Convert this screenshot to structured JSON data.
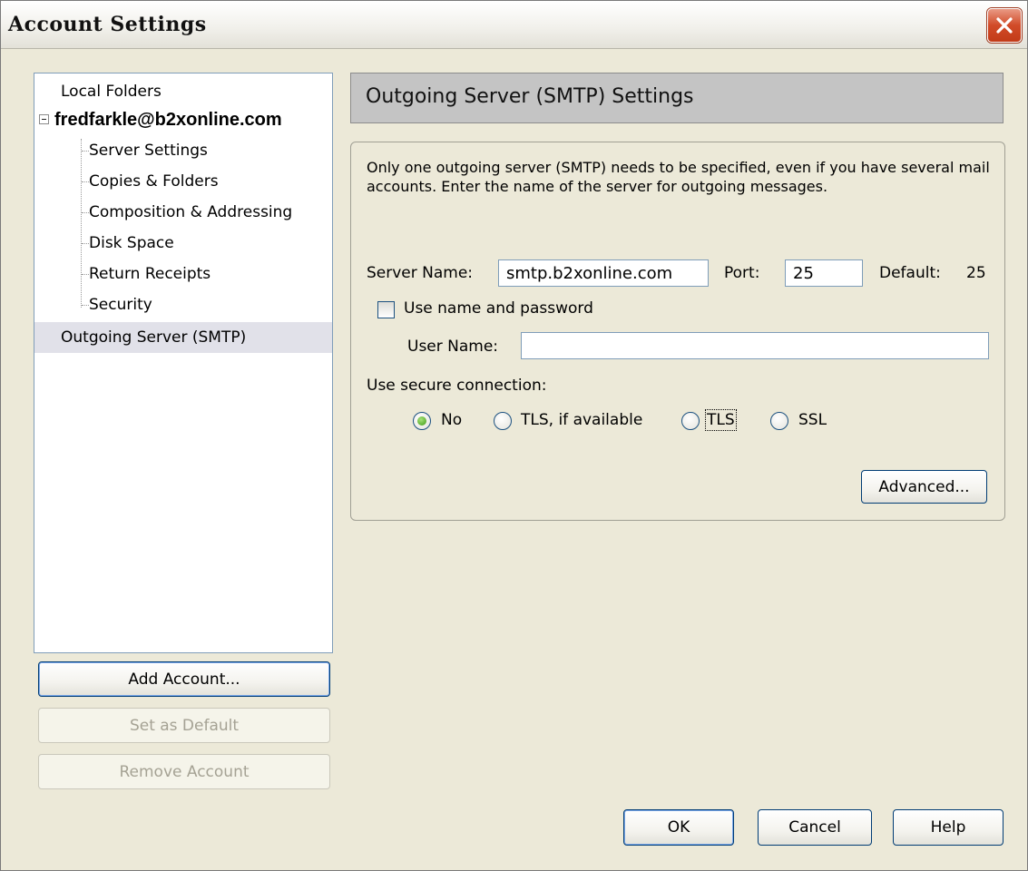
{
  "window": {
    "title": "Account Settings",
    "close_icon": "close-icon"
  },
  "tree": {
    "local_folders": "Local Folders",
    "account": "fredfarkle@b2xonline.com",
    "children": [
      {
        "label": "Server Settings"
      },
      {
        "label": "Copies & Folders"
      },
      {
        "label": "Composition & Addressing"
      },
      {
        "label": "Disk Space"
      },
      {
        "label": "Return Receipts"
      },
      {
        "label": "Security"
      }
    ],
    "outgoing": "Outgoing Server (SMTP)",
    "selected": "Outgoing Server (SMTP)"
  },
  "account_buttons": {
    "add": "Add Account...",
    "set_default": "Set as Default",
    "remove": "Remove Account"
  },
  "panel": {
    "title": "Outgoing Server (SMTP) Settings",
    "description": "Only one outgoing server (SMTP) needs to be specified, even if you have several mail accounts. Enter the name of the server for outgoing messages.",
    "server_name_label": "Server Name:",
    "server_name_value": "smtp.b2xonline.com",
    "port_label": "Port:",
    "port_value": "25",
    "default_label": "Default:",
    "default_value": "25",
    "use_name_password": {
      "label": "Use name and password",
      "checked": false
    },
    "user_name_label": "User Name:",
    "user_name_value": "",
    "secure_label": "Use secure connection:",
    "secure_options": [
      {
        "label": "No",
        "checked": true
      },
      {
        "label": "TLS, if available",
        "checked": false
      },
      {
        "label": "TLS",
        "checked": false
      },
      {
        "label": "SSL",
        "checked": false
      }
    ],
    "advanced_label": "Advanced..."
  },
  "footer": {
    "ok": "OK",
    "cancel": "Cancel",
    "help": "Help"
  },
  "colors": {
    "dialog_bg": "#ece9d8",
    "header_bg": "#c4c4c4",
    "selection_bg": "#e1e1e9",
    "button_border": "#003c74",
    "close_red": "#d14b28"
  }
}
